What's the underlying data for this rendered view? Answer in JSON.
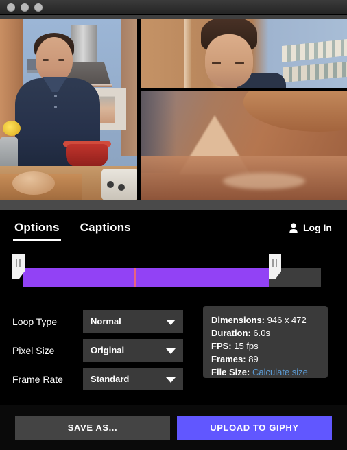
{
  "window": {
    "traffic_lights": [
      "close",
      "minimize",
      "zoom"
    ]
  },
  "preview": {
    "panes": [
      {
        "name": "main-video-frame",
        "description": "Man in navy polo shirt working at a kitchen counter with a range hood"
      },
      {
        "name": "zoom-video-frame-top",
        "description": "Close-up of man's face against a tan wall"
      },
      {
        "name": "zoom-video-frame-bottom",
        "description": "Close-up of bread dough being folded"
      }
    ]
  },
  "tabs": [
    {
      "id": "options",
      "label": "Options",
      "active": true
    },
    {
      "id": "captions",
      "label": "Captions",
      "active": false
    }
  ],
  "account": {
    "login_label": "Log In",
    "icon": "person-icon"
  },
  "timeline": {
    "selection_start_pct": 0,
    "selection_end_pct": 82.5,
    "playhead_pct": 37.3,
    "track_color": "#3d3d3d",
    "selection_color": "#9242f5",
    "playhead_color": "#e8647f",
    "handle_left": "trim-start-handle",
    "handle_right": "trim-end-handle"
  },
  "controls": [
    {
      "id": "loop-type",
      "label": "Loop Type",
      "value": "Normal"
    },
    {
      "id": "pixel-size",
      "label": "Pixel Size",
      "value": "Original"
    },
    {
      "id": "frame-rate",
      "label": "Frame Rate",
      "value": "Standard"
    }
  ],
  "info": {
    "dimensions": {
      "key": "Dimensions:",
      "value": "946 x 472"
    },
    "duration": {
      "key": "Duration:",
      "value": "6.0s"
    },
    "fps": {
      "key": "FPS:",
      "value": "15 fps"
    },
    "frames": {
      "key": "Frames:",
      "value": "89"
    },
    "filesize": {
      "key": "File Size:",
      "link": "Calculate size",
      "link_color": "#5b9bd5"
    }
  },
  "footer": {
    "save_label": "SAVE AS...",
    "upload_label": "UPLOAD TO GIPHY",
    "upload_color": "#6157ff"
  }
}
